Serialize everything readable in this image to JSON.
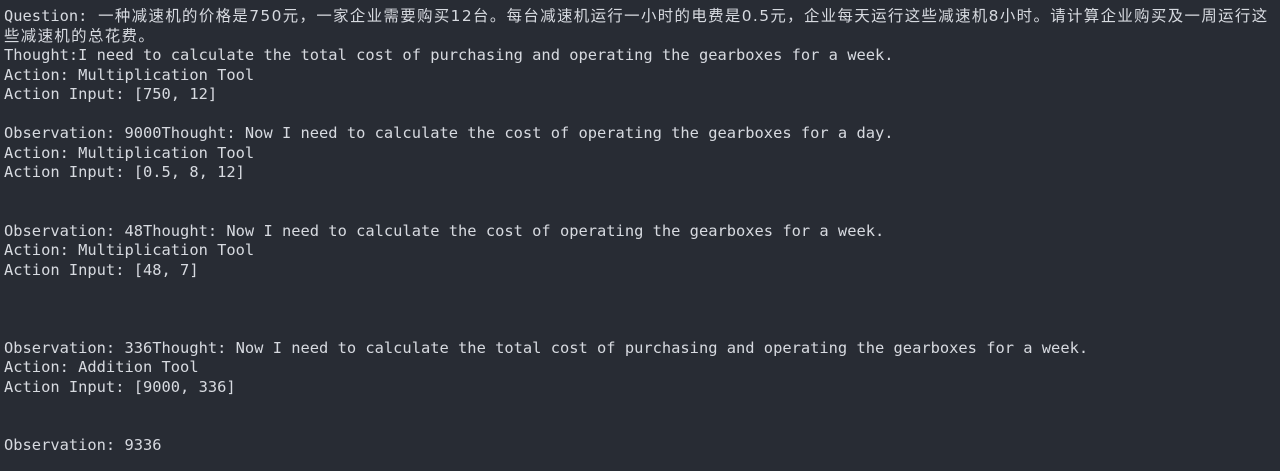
{
  "terminal": {
    "background": "#282c34",
    "foreground": "#d7dae0",
    "question_label": "Question:",
    "question_text": "一种减速机的价格是750元，一家企业需要购买12台。每台减速机运行一小时的电费是0.5元，企业每天运行这些减速机8小时。请计算企业购买及一周运行这些减速机的总花费。",
    "lines": {
      "l1": "Thought:I need to calculate the total cost of purchasing and operating the gearboxes for a week.",
      "l2": "Action: Multiplication Tool",
      "l3": "Action Input: [750, 12]",
      "l4": "Observation: 9000Thought: Now I need to calculate the cost of operating the gearboxes for a day.",
      "l5": "Action: Multiplication Tool",
      "l6": "Action Input: [0.5, 8, 12]",
      "l7": "Observation: 48Thought: Now I need to calculate the cost of operating the gearboxes for a week.",
      "l8": "Action: Multiplication Tool",
      "l9": "Action Input: [48, 7]",
      "l10": "Observation: 336Thought: Now I need to calculate the total cost of purchasing and operating the gearboxes for a week.",
      "l11": "Action: Addition Tool",
      "l12": "Action Input: [9000, 336]",
      "l13": "Observation: 9336"
    }
  }
}
